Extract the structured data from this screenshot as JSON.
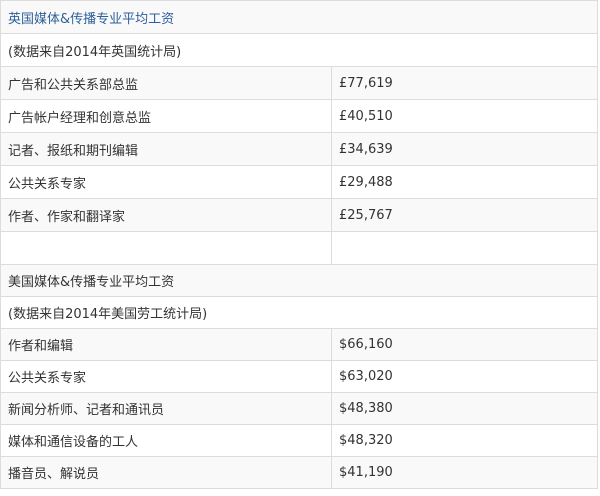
{
  "uk": {
    "title": "英国媒体&传播专业平均工资",
    "source": "(数据来自2014年英国统计局)",
    "rows": [
      {
        "job": "广告和公共关系部总监",
        "salary": "£77,619"
      },
      {
        "job": "广告帐户经理和创意总监",
        "salary": "£40,510"
      },
      {
        "job": "记者、报纸和期刊编辑",
        "salary": "£34,639"
      },
      {
        "job": "公共关系专家",
        "salary": "£29,488"
      },
      {
        "job": "作者、作家和翻译家",
        "salary": "£25,767"
      }
    ]
  },
  "us": {
    "title": "美国媒体&传播专业平均工资",
    "source": "(数据来自2014年美国劳工统计局)",
    "rows": [
      {
        "job": "作者和编辑",
        "salary": "$66,160"
      },
      {
        "job": "公共关系专家",
        "salary": "$63,020"
      },
      {
        "job": "新闻分析师、记者和通讯员",
        "salary": "$48,380"
      },
      {
        "job": "媒体和通信设备的工人",
        "salary": "$48,320"
      },
      {
        "job": "播音员、解说员",
        "salary": "$41,190"
      }
    ]
  },
  "colors": {
    "title_link": "#2d5f9a",
    "text": "#333333",
    "border": "#dcdcdc",
    "stripe": "#f9f9f9"
  }
}
